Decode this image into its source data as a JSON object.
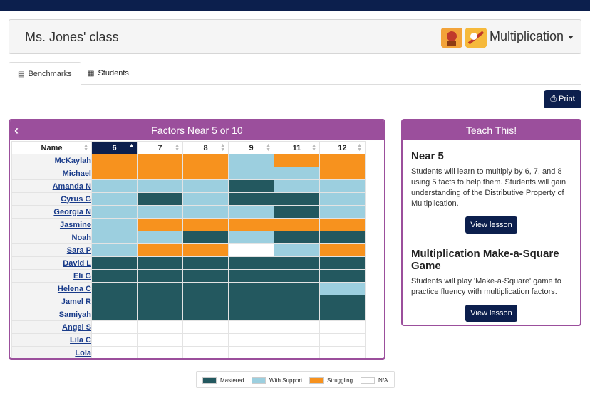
{
  "header": {
    "class_title": "Ms. Jones' class",
    "subject": "Multiplication",
    "print_label": "Print"
  },
  "tabs": [
    {
      "label": "Benchmarks",
      "icon": "bar-chart-icon",
      "active": true
    },
    {
      "label": "Students",
      "icon": "grid-icon",
      "active": false
    }
  ],
  "colors": {
    "mastered": "#23585f",
    "with_support": "#9ccfdf",
    "struggling": "#f7921e",
    "na": "#ffffff",
    "panel": "#9b4f9c",
    "navy": "#0c1f4d"
  },
  "grid": {
    "title": "Factors Near 5 or 10",
    "name_header": "Name",
    "columns": [
      "6",
      "7",
      "8",
      "9",
      "11",
      "12"
    ],
    "selected_column": "6",
    "students": [
      {
        "name": "McKaylah",
        "cells": [
          "S",
          "S",
          "S",
          "W",
          "S",
          "S"
        ]
      },
      {
        "name": "Michael",
        "cells": [
          "S",
          "S",
          "S",
          "W",
          "W",
          "S"
        ]
      },
      {
        "name": "Amanda N",
        "cells": [
          "W",
          "W",
          "W",
          "M",
          "W",
          "W"
        ]
      },
      {
        "name": "Cyrus G",
        "cells": [
          "W",
          "M",
          "W",
          "M",
          "M",
          "W"
        ]
      },
      {
        "name": "Georgia N",
        "cells": [
          "W",
          "W",
          "W",
          "W",
          "M",
          "W"
        ]
      },
      {
        "name": "Jasmine",
        "cells": [
          "W",
          "S",
          "S",
          "S",
          "S",
          "S"
        ]
      },
      {
        "name": "Noah",
        "cells": [
          "W",
          "W",
          "M",
          "W",
          "M",
          "M"
        ]
      },
      {
        "name": "Sara P",
        "cells": [
          "W",
          "S",
          "S",
          "N",
          "W",
          "S"
        ]
      },
      {
        "name": "David L",
        "cells": [
          "M",
          "M",
          "M",
          "M",
          "M",
          "M"
        ]
      },
      {
        "name": "Eli G",
        "cells": [
          "M",
          "M",
          "M",
          "M",
          "M",
          "M"
        ]
      },
      {
        "name": "Helena C",
        "cells": [
          "M",
          "M",
          "M",
          "M",
          "M",
          "W"
        ]
      },
      {
        "name": "Jamel R",
        "cells": [
          "M",
          "M",
          "M",
          "M",
          "M",
          "M"
        ]
      },
      {
        "name": "Samiyah",
        "cells": [
          "M",
          "M",
          "M",
          "M",
          "M",
          "M"
        ]
      },
      {
        "name": "Angel S",
        "cells": [
          "N",
          "N",
          "N",
          "N",
          "N",
          "N"
        ]
      },
      {
        "name": "Lila C",
        "cells": [
          "N",
          "N",
          "N",
          "N",
          "N",
          "N"
        ]
      },
      {
        "name": "Lola",
        "cells": [
          "N",
          "N",
          "N",
          "N",
          "N",
          "N"
        ]
      }
    ]
  },
  "teach": {
    "title": "Teach This!",
    "lessons": [
      {
        "title": "Near 5",
        "description": "Students will learn to multiply by 6, 7, and 8 using 5 facts to help them. Students will gain understanding of the Distributive Property of Multiplication.",
        "button": "View lesson"
      },
      {
        "title": "Multiplication Make-a-Square Game",
        "description": "Students will play 'Make-a-Square' game to practice fluency with multiplication factors.",
        "button": "View lesson"
      }
    ]
  },
  "legend": [
    {
      "label": "Mastered",
      "key": "M"
    },
    {
      "label": "With Support",
      "key": "W"
    },
    {
      "label": "Struggling",
      "key": "S"
    },
    {
      "label": "N/A",
      "key": "N"
    }
  ]
}
